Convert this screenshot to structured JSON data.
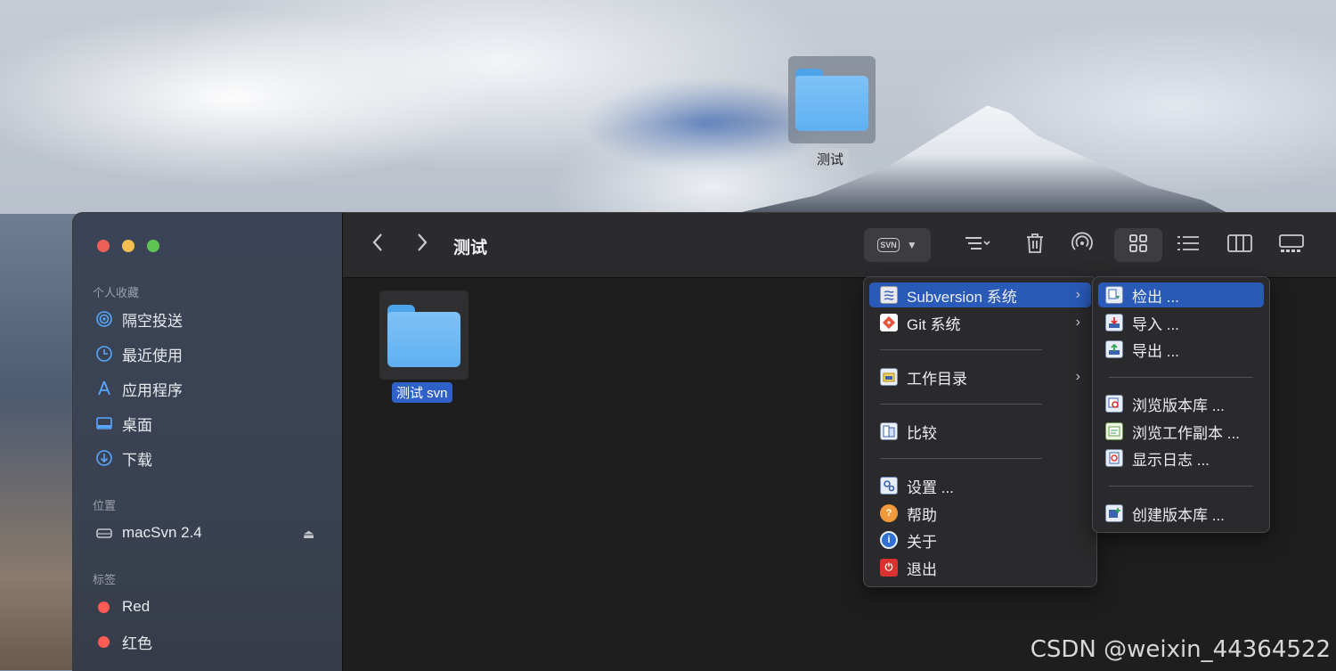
{
  "desktop": {
    "folder_label": "测试"
  },
  "window": {
    "title": "测试",
    "sidebar": {
      "favorites_header": "个人收藏",
      "favorites": [
        {
          "label": "隔空投送",
          "icon": "airdrop-icon"
        },
        {
          "label": "最近使用",
          "icon": "clock-icon"
        },
        {
          "label": "应用程序",
          "icon": "applications-icon"
        },
        {
          "label": "桌面",
          "icon": "desktop-icon"
        },
        {
          "label": "下载",
          "icon": "download-icon"
        }
      ],
      "locations_header": "位置",
      "locations": [
        {
          "label": "macSvn 2.4",
          "icon": "disk-icon"
        }
      ],
      "tags_header": "标签",
      "tags": [
        {
          "label": "Red",
          "color": "#ff5c55"
        },
        {
          "label": "红色",
          "color": "#ff5c55"
        }
      ]
    },
    "toolbar": {
      "svn_badge": "SVN"
    },
    "files": [
      {
        "name": "测试 svn",
        "selected": true
      }
    ]
  },
  "menu": {
    "items": [
      {
        "label": "Subversion 系统",
        "icon": "subversion-icon",
        "submenu": true,
        "highlighted": true
      },
      {
        "label": "Git 系统",
        "icon": "git-icon",
        "submenu": true
      },
      {
        "label": "工作目录",
        "icon": "working-dir-icon",
        "submenu": true
      },
      {
        "label": "比较",
        "icon": "compare-icon"
      },
      {
        "label": "设置 ...",
        "icon": "settings-icon"
      },
      {
        "label": "帮助",
        "icon": "help-icon"
      },
      {
        "label": "关于",
        "icon": "about-icon"
      },
      {
        "label": "退出",
        "icon": "quit-icon"
      }
    ]
  },
  "submenu": {
    "items": [
      {
        "label": "检出 ...",
        "icon": "checkout-icon",
        "highlighted": true
      },
      {
        "label": "导入 ...",
        "icon": "import-icon"
      },
      {
        "label": "导出 ...",
        "icon": "export-icon"
      },
      {
        "label": "浏览版本库 ...",
        "icon": "browse-repo-icon"
      },
      {
        "label": "浏览工作副本 ...",
        "icon": "browse-working-copy-icon"
      },
      {
        "label": "显示日志 ...",
        "icon": "show-log-icon"
      },
      {
        "label": "创建版本库 ...",
        "icon": "create-repo-icon"
      }
    ]
  },
  "watermark": "CSDN @weixin_44364522",
  "colors": {
    "selection": "#2a5ab8",
    "folder": "#5fb0f2",
    "tag_red": "#ff5c55"
  }
}
